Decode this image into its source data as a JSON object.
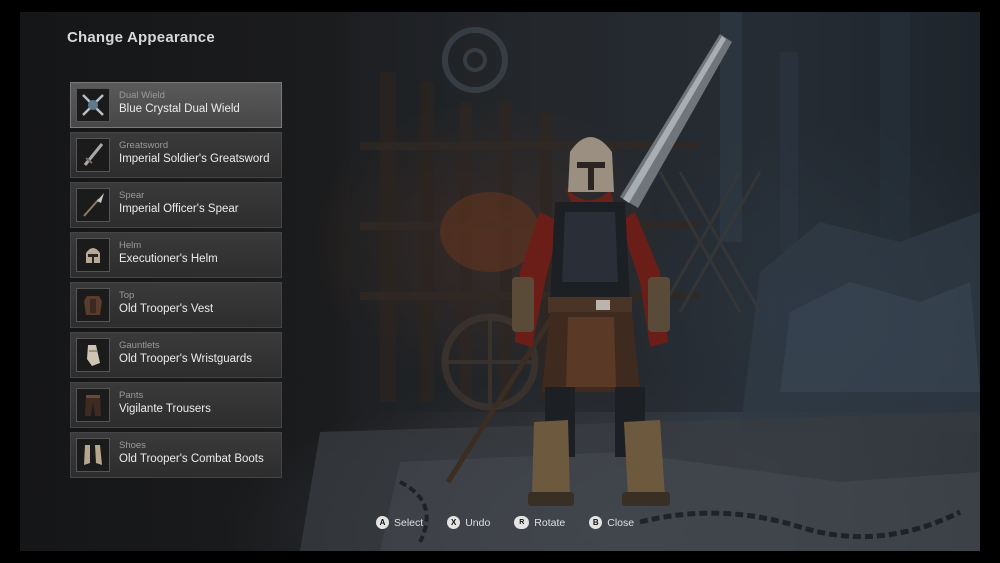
{
  "screen": {
    "title": "Change Appearance"
  },
  "slots": [
    {
      "category": "Dual Wield",
      "name": "Blue Crystal Dual Wield",
      "icon": "dual-wield-icon",
      "selected": true
    },
    {
      "category": "Greatsword",
      "name": "Imperial Soldier's Greatsword",
      "icon": "greatsword-icon",
      "selected": false
    },
    {
      "category": "Spear",
      "name": "Imperial Officer's Spear",
      "icon": "spear-icon",
      "selected": false
    },
    {
      "category": "Helm",
      "name": "Executioner's Helm",
      "icon": "helm-icon",
      "selected": false
    },
    {
      "category": "Top",
      "name": "Old Trooper's Vest",
      "icon": "vest-icon",
      "selected": false
    },
    {
      "category": "Gauntlets",
      "name": "Old Trooper's Wristguards",
      "icon": "gauntlet-icon",
      "selected": false
    },
    {
      "category": "Pants",
      "name": "Vigilante Trousers",
      "icon": "trousers-icon",
      "selected": false
    },
    {
      "category": "Shoes",
      "name": "Old Trooper's Combat Boots",
      "icon": "boots-icon",
      "selected": false
    }
  ],
  "prompts": [
    {
      "button": "A",
      "label": "Select"
    },
    {
      "button": "X",
      "label": "Undo"
    },
    {
      "button": "R",
      "label": "Rotate"
    },
    {
      "button": "B",
      "label": "Close"
    }
  ]
}
